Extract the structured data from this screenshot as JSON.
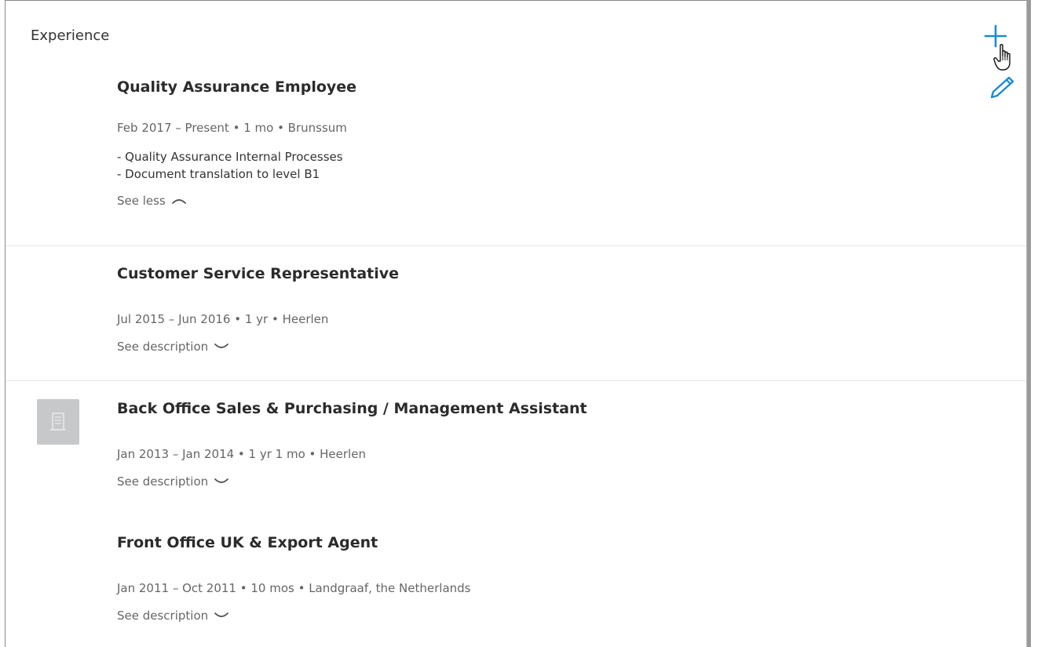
{
  "section": {
    "title": "Experience"
  },
  "actions": {
    "add_icon": "plus-icon",
    "edit_icon": "pencil-icon",
    "accent": "#1c8cd0"
  },
  "entries": [
    {
      "title": "Quality Assurance Employee",
      "meta": "Feb 2017 – Present • 1 mo • Brunssum",
      "description": [
        "- Quality Assurance Internal Processes",
        "- Document translation to level B1"
      ],
      "toggle": "See less",
      "toggle_icon": "chevron-up-icon"
    },
    {
      "title": "Customer Service Representative",
      "meta": "Jul 2015 – Jun 2016 • 1 yr • Heerlen",
      "toggle": "See description",
      "toggle_icon": "chevron-down-icon"
    },
    {
      "title": "Back Office Sales & Purchasing / Management Assistant",
      "meta": "Jan 2013 – Jan 2014 • 1 yr 1 mo • Heerlen",
      "toggle": "See description",
      "toggle_icon": "chevron-down-icon",
      "logo_icon": "company-building-icon"
    },
    {
      "title": "Front Office UK & Export Agent",
      "meta": "Jan 2011 – Oct 2011 • 10 mos • Landgraaf, the Netherlands",
      "toggle": "See description",
      "toggle_icon": "chevron-down-icon"
    }
  ]
}
